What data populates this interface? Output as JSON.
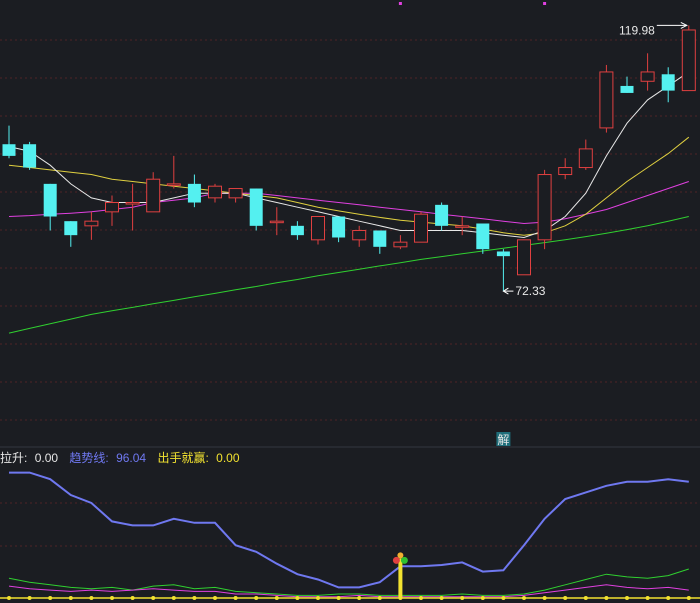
{
  "chart_data": {
    "type": "candlestick",
    "price_axis": {
      "min": 30,
      "max": 125
    },
    "candles": [
      {
        "o": 94.5,
        "h": 98.5,
        "l": 91.5,
        "c": 92.0
      },
      {
        "o": 94.5,
        "h": 95.0,
        "l": 89.0,
        "c": 89.5
      },
      {
        "o": 86.0,
        "h": 86.0,
        "l": 76.0,
        "c": 79.0
      },
      {
        "o": 78.0,
        "h": 78.0,
        "l": 72.5,
        "c": 75.0
      },
      {
        "o": 77.0,
        "h": 80.0,
        "l": 74.0,
        "c": 78.0
      },
      {
        "o": 80.0,
        "h": 83.5,
        "l": 77.0,
        "c": 82.0
      },
      {
        "o": 82.0,
        "h": 86.0,
        "l": 76.0,
        "c": 82.0
      },
      {
        "o": 80.0,
        "h": 88.5,
        "l": 80.0,
        "c": 87.0
      },
      {
        "o": 86.0,
        "h": 92.0,
        "l": 85.0,
        "c": 86.0
      },
      {
        "o": 86.0,
        "h": 88.0,
        "l": 81.0,
        "c": 82.0
      },
      {
        "o": 83.0,
        "h": 86.0,
        "l": 82.0,
        "c": 85.5
      },
      {
        "o": 83.0,
        "h": 85.0,
        "l": 82.0,
        "c": 85.0
      },
      {
        "o": 85.0,
        "h": 85.0,
        "l": 76.0,
        "c": 77.0
      },
      {
        "o": 78.0,
        "h": 81.0,
        "l": 75.0,
        "c": 78.0
      },
      {
        "o": 77.0,
        "h": 78.0,
        "l": 74.0,
        "c": 75.0
      },
      {
        "o": 74.0,
        "h": 79.0,
        "l": 73.0,
        "c": 79.0
      },
      {
        "o": 79.0,
        "h": 79.0,
        "l": 73.5,
        "c": 74.5
      },
      {
        "o": 74.0,
        "h": 77.0,
        "l": 72.5,
        "c": 76.0
      },
      {
        "o": 76.0,
        "h": 76.0,
        "l": 71.0,
        "c": 72.5
      },
      {
        "o": 72.5,
        "h": 75.0,
        "l": 72.0,
        "c": 73.5
      },
      {
        "o": 73.5,
        "h": 80.0,
        "l": 73.5,
        "c": 79.5
      },
      {
        "o": 81.5,
        "h": 82.0,
        "l": 76.0,
        "c": 77.0
      },
      {
        "o": 77.0,
        "h": 79.0,
        "l": 75.0,
        "c": 77.0
      },
      {
        "o": 77.5,
        "h": 77.5,
        "l": 71.0,
        "c": 72.0
      },
      {
        "o": 71.5,
        "h": 72.0,
        "l": 63.0,
        "c": 70.5
      },
      {
        "o": 66.5,
        "h": 74.0,
        "l": 66.5,
        "c": 74.0
      },
      {
        "o": 74.0,
        "h": 89.0,
        "l": 72.0,
        "c": 88.0
      },
      {
        "o": 88.0,
        "h": 91.5,
        "l": 87.0,
        "c": 89.5
      },
      {
        "o": 89.5,
        "h": 95.5,
        "l": 89.0,
        "c": 93.5
      },
      {
        "o": 98.0,
        "h": 111.5,
        "l": 97.0,
        "c": 110.0
      },
      {
        "o": 107.0,
        "h": 109.0,
        "l": 105.5,
        "c": 105.5
      },
      {
        "o": 108.0,
        "h": 114.0,
        "l": 106.0,
        "c": 110.0
      },
      {
        "o": 109.5,
        "h": 111.0,
        "l": 103.5,
        "c": 106.0
      },
      {
        "o": 106.0,
        "h": 119.98,
        "l": 106.0,
        "c": 119.0
      }
    ],
    "ma_fast": [
      94,
      93,
      90,
      86,
      83,
      82,
      82,
      82,
      83,
      84,
      84,
      84,
      83,
      82,
      81,
      80,
      79,
      78,
      77,
      76,
      76,
      76,
      76,
      75.5,
      75,
      74.5,
      76,
      79,
      84,
      92,
      99,
      104,
      107,
      110
    ],
    "ma_mid": [
      90,
      89.5,
      89,
      88.5,
      88,
      87,
      86.5,
      86,
      85.5,
      85,
      84.5,
      84,
      83.5,
      83,
      82,
      81,
      80.2,
      79.5,
      78.8,
      78.2,
      77.8,
      77.4,
      77,
      76.3,
      75.5,
      75,
      75.5,
      77,
      79.5,
      83,
      86.5,
      89.5,
      92.5,
      96
    ],
    "ma_slow": [
      79,
      79.2,
      79.5,
      79.7,
      80,
      80.5,
      81,
      82,
      82.5,
      83,
      84,
      84,
      84,
      83.5,
      83,
      82.5,
      82,
      81.5,
      81,
      80.5,
      80,
      79.5,
      79,
      78.5,
      78,
      77.5,
      77.8,
      78.5,
      79.5,
      80.5,
      82,
      83.5,
      85,
      86.5
    ],
    "ma_long": [
      54,
      55,
      56,
      57,
      58,
      58.8,
      59.5,
      60.3,
      61,
      61.8,
      62.5,
      63.3,
      64,
      64.8,
      65.5,
      66.3,
      67,
      67.7,
      68.4,
      69.1,
      69.8,
      70.4,
      71,
      71.6,
      72.2,
      72.8,
      73.4,
      74,
      74.7,
      75.4,
      76.2,
      77,
      78,
      79
    ],
    "high_label": "119.98",
    "low_label": "72.33",
    "high_index": 33,
    "low_index": 24,
    "signal_marker": "解",
    "signal_index": 24,
    "top_markers_index": [
      19,
      26
    ],
    "indicator": {
      "axis": {
        "min": 0,
        "max": 100
      },
      "legend": [
        {
          "label": "拉升:",
          "value": "0.00",
          "color": "#e6e6e6"
        },
        {
          "label": "趋势线:",
          "value": "96.04",
          "color": "#6f78f0"
        },
        {
          "label": "出手就赢:",
          "value": "0.00",
          "color": "#f2e230"
        }
      ],
      "trend": [
        95,
        95,
        90,
        78,
        72,
        58,
        55,
        55,
        60,
        57,
        57,
        40,
        35,
        26,
        18,
        14,
        8,
        8,
        12,
        24,
        24,
        25,
        27,
        20,
        21,
        40,
        60,
        75,
        80,
        85,
        88,
        88,
        90,
        88
      ],
      "green": [
        15,
        12,
        10,
        8,
        7,
        8,
        6,
        9,
        10,
        7,
        8,
        5,
        4,
        3,
        2,
        2,
        3,
        3,
        2,
        2,
        2,
        2,
        3,
        2,
        2,
        3,
        6,
        10,
        14,
        18,
        16,
        15,
        17,
        22
      ],
      "magenta": [
        9,
        7,
        6,
        5,
        6,
        5,
        6,
        7,
        6,
        5,
        5,
        3,
        3,
        2,
        1,
        1,
        1,
        2,
        1,
        1,
        1,
        1,
        1,
        1,
        1,
        2,
        4,
        6,
        8,
        10,
        8,
        7,
        8,
        6
      ],
      "signal_bar_index": 19,
      "signal_bar_value": 30
    },
    "colors": {
      "up": "#e04040",
      "down": "#54f0f0",
      "ma_fast": "#e8e8e8",
      "ma_mid": "#e0d040",
      "ma_slow": "#e040e0",
      "ma_long": "#30d030",
      "grid": "#7a2a2a",
      "bg": "#1b1d22"
    }
  }
}
